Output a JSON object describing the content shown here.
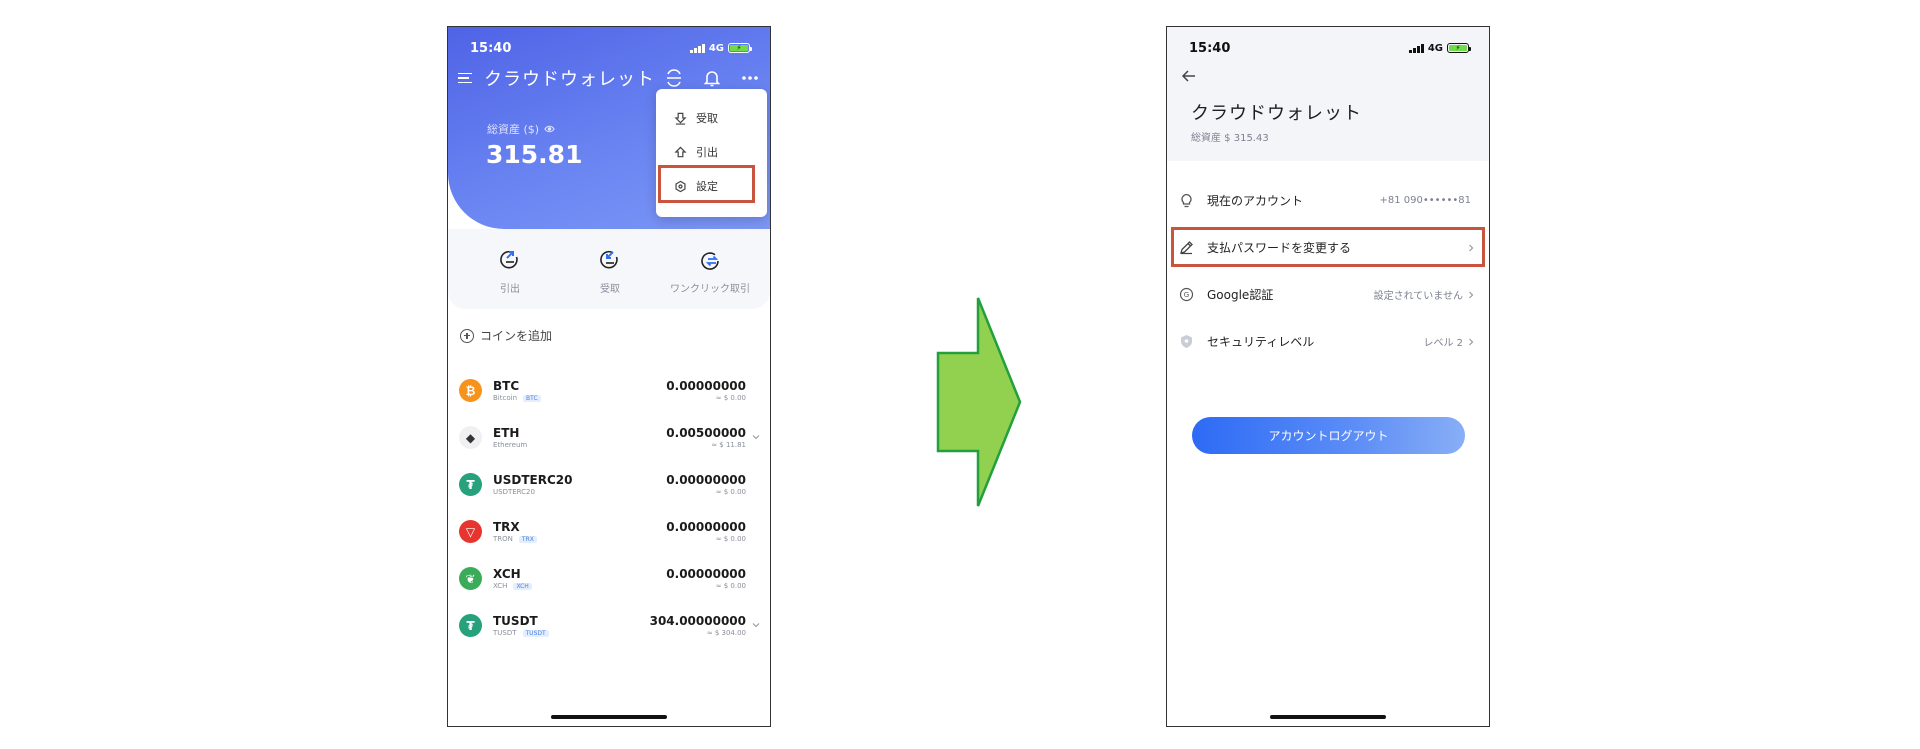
{
  "left": {
    "status": {
      "time": "15:40",
      "network": "4G"
    },
    "title": "クラウドウォレット",
    "total_label": "総資産 ($)",
    "total_value": "315.81",
    "menu": {
      "items": [
        "受取",
        "引出",
        "設定"
      ]
    },
    "actions": [
      "引出",
      "受取",
      "ワンクリック取引"
    ],
    "add_coin": "コインを追加",
    "coins": [
      {
        "symbol": "BTC",
        "name": "Bitcoin",
        "tag": "BTC",
        "amount": "0.00000000",
        "usd": "≈ $ 0.00",
        "color": "#f7931a",
        "glyph": "₿",
        "chevron": false
      },
      {
        "symbol": "ETH",
        "name": "Ethereum",
        "tag": "",
        "amount": "0.00500000",
        "usd": "≈ $ 11.81",
        "color": "#f0f0f3",
        "glyph": "◆",
        "chevron": true
      },
      {
        "symbol": "USDTERC20",
        "name": "USDTERC20",
        "tag": "",
        "amount": "0.00000000",
        "usd": "≈ $ 0.00",
        "color": "#26a17b",
        "glyph": "₮",
        "chevron": false
      },
      {
        "symbol": "TRX",
        "name": "TRON",
        "tag": "TRX",
        "amount": "0.00000000",
        "usd": "≈ $ 0.00",
        "color": "#e8342f",
        "glyph": "▽",
        "chevron": false
      },
      {
        "symbol": "XCH",
        "name": "XCH",
        "tag": "XCH",
        "amount": "0.00000000",
        "usd": "≈ $ 0.00",
        "color": "#3aac59",
        "glyph": "❦",
        "chevron": false
      },
      {
        "symbol": "TUSDT",
        "name": "TUSDT",
        "tag": "TUSDT",
        "amount": "304.00000000",
        "usd": "≈ $ 304.00",
        "color": "#26a17b",
        "glyph": "₮",
        "chevron": true
      }
    ]
  },
  "right": {
    "status": {
      "time": "15:40",
      "network": "4G"
    },
    "title": "クラウドウォレット",
    "total": "総資産 $ 315.43",
    "rows": [
      {
        "label": "現在のアカウント",
        "value": "+81 090••••••81",
        "chevron": false
      },
      {
        "label": "支払パスワードを変更する",
        "value": "",
        "chevron": true
      },
      {
        "label": "Google認証",
        "value": "設定されていません",
        "chevron": true
      },
      {
        "label": "セキュリティレベル",
        "value": "レベル 2",
        "chevron": true
      }
    ],
    "logout": "アカウントログアウト"
  },
  "colors": {
    "accent": "#4f63e6",
    "highlight": "#c9543d",
    "arrow": "#92d050",
    "arrow_border": "#21a03b"
  }
}
